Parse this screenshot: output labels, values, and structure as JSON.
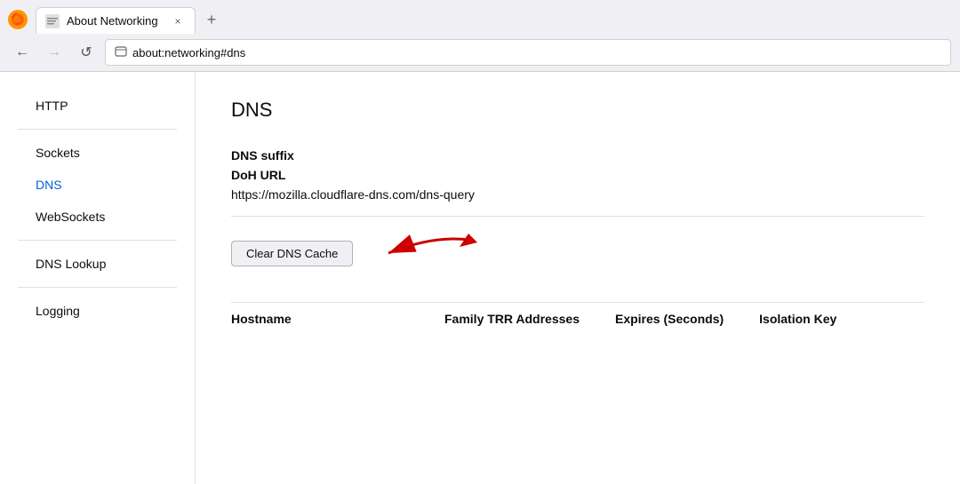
{
  "browser": {
    "tab": {
      "title": "About Networking",
      "close_label": "×"
    },
    "new_tab_label": "+",
    "nav": {
      "back_label": "←",
      "forward_label": "→",
      "reload_label": "↺",
      "address": "about:networking#dns"
    }
  },
  "sidebar": {
    "items": [
      {
        "id": "http",
        "label": "HTTP",
        "active": false
      },
      {
        "id": "sockets",
        "label": "Sockets",
        "active": false
      },
      {
        "id": "dns",
        "label": "DNS",
        "active": true
      },
      {
        "id": "websockets",
        "label": "WebSockets",
        "active": false
      },
      {
        "id": "dns-lookup",
        "label": "DNS Lookup",
        "active": false
      },
      {
        "id": "logging",
        "label": "Logging",
        "active": false
      }
    ]
  },
  "main": {
    "page_title": "DNS",
    "dns_suffix_label": "DNS suffix",
    "doh_url_label": "DoH URL",
    "doh_url_value": "https://mozilla.cloudflare-dns.com/dns-query",
    "clear_btn_label": "Clear DNS Cache",
    "table_headers": {
      "hostname": "Hostname",
      "family_trr": "Family TRR Addresses",
      "expires": "Expires (Seconds)",
      "isolation_key": "Isolation Key"
    }
  }
}
